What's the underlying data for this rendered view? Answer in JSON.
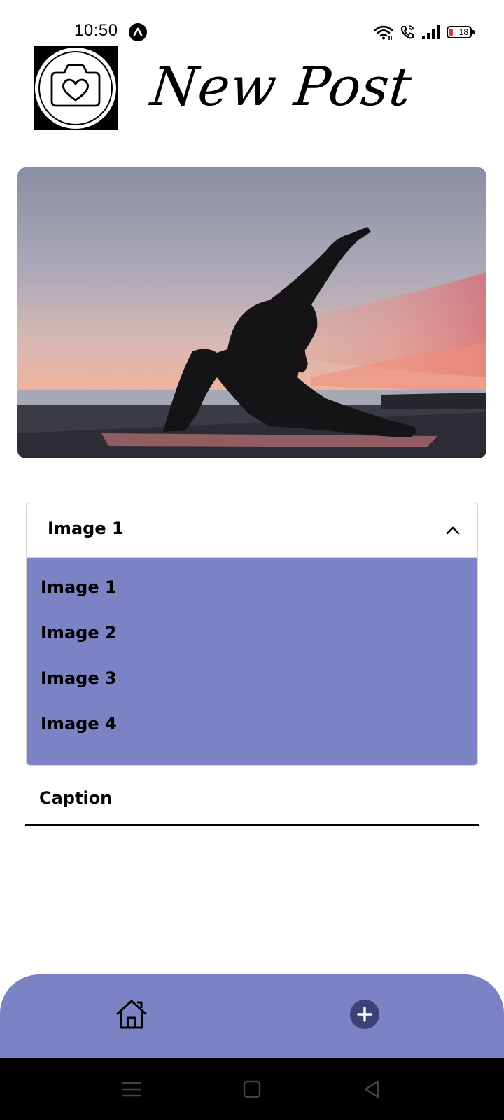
{
  "status_bar": {
    "time": "10:50",
    "battery": "18",
    "icons": [
      "notification-icon",
      "wifi-icon",
      "wifi-calling-icon",
      "signal-icon",
      "battery-icon"
    ]
  },
  "header": {
    "title": "New Post",
    "logo_icon": "camera-heart-icon"
  },
  "photo": {
    "subject": "yoga-silhouette-sunset-photo"
  },
  "dropdown": {
    "selected": "Image 1",
    "expanded": true,
    "options": [
      "Image 1",
      "Image 2",
      "Image 3",
      "Image 4"
    ]
  },
  "caption": {
    "placeholder": "Caption",
    "value": ""
  },
  "bottom_nav": {
    "items": [
      "home-icon",
      "add-icon"
    ]
  },
  "system_nav": {
    "items": [
      "menu-icon",
      "home-square-icon",
      "back-icon"
    ]
  },
  "colors": {
    "accent": "#7b83c5",
    "add_button": "#3c4178",
    "battery_low": "#e53935"
  }
}
